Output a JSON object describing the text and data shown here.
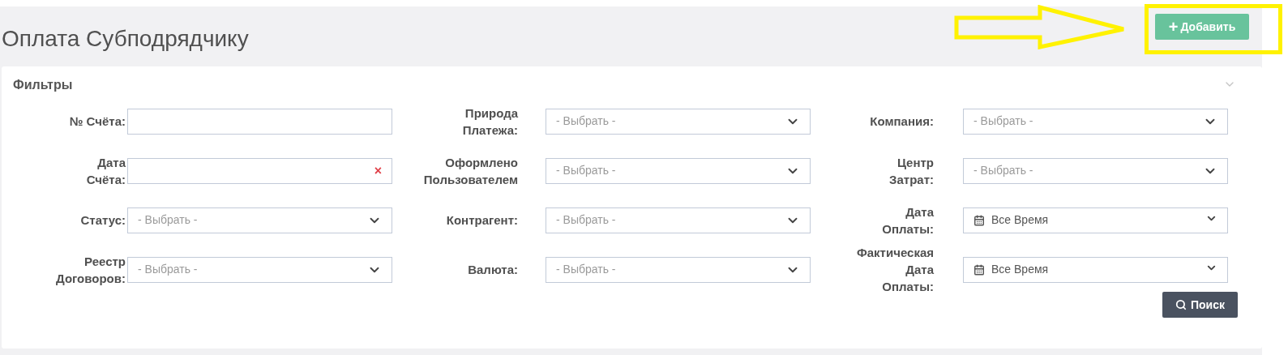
{
  "page": {
    "title": "Оплата Субподрядчику",
    "add_button": {
      "icon": "+",
      "label": "Добавить"
    }
  },
  "filters": {
    "title": "Фильтры",
    "expanded": true,
    "rows": [
      [
        {
          "label": "№ Счёта:",
          "kind": "text"
        },
        {
          "label": "Природа Платежа:",
          "kind": "select",
          "placeholder": "- Выбрать -"
        },
        {
          "label": "Компания:",
          "kind": "select",
          "placeholder": "- Выбрать -"
        }
      ],
      [
        {
          "label": "Дата Счёта:",
          "kind": "date",
          "clear": "×"
        },
        {
          "label": "Оформлено Пользователем",
          "kind": "select",
          "placeholder": "- Выбрать -"
        },
        {
          "label": "Центр Затрат:",
          "kind": "select",
          "placeholder": "- Выбрать -"
        }
      ],
      [
        {
          "label": "Статус:",
          "kind": "select",
          "placeholder": "- Выбрать -"
        },
        {
          "label": "Контрагент:",
          "kind": "select",
          "placeholder": "- Выбрать -"
        },
        {
          "label": "Дата Оплаты:",
          "kind": "daterange",
          "value": "Все Время"
        }
      ],
      [
        {
          "label": "Реестр Договоров:",
          "kind": "select",
          "placeholder": "- Выбрать -"
        },
        {
          "label": "Валюта:",
          "kind": "select",
          "placeholder": "- Выбрать -"
        },
        {
          "label": "Фактическая Дата Оплаты:",
          "kind": "daterange",
          "value": "Все Время"
        }
      ]
    ],
    "search_button": {
      "label": "Поиск"
    }
  }
}
